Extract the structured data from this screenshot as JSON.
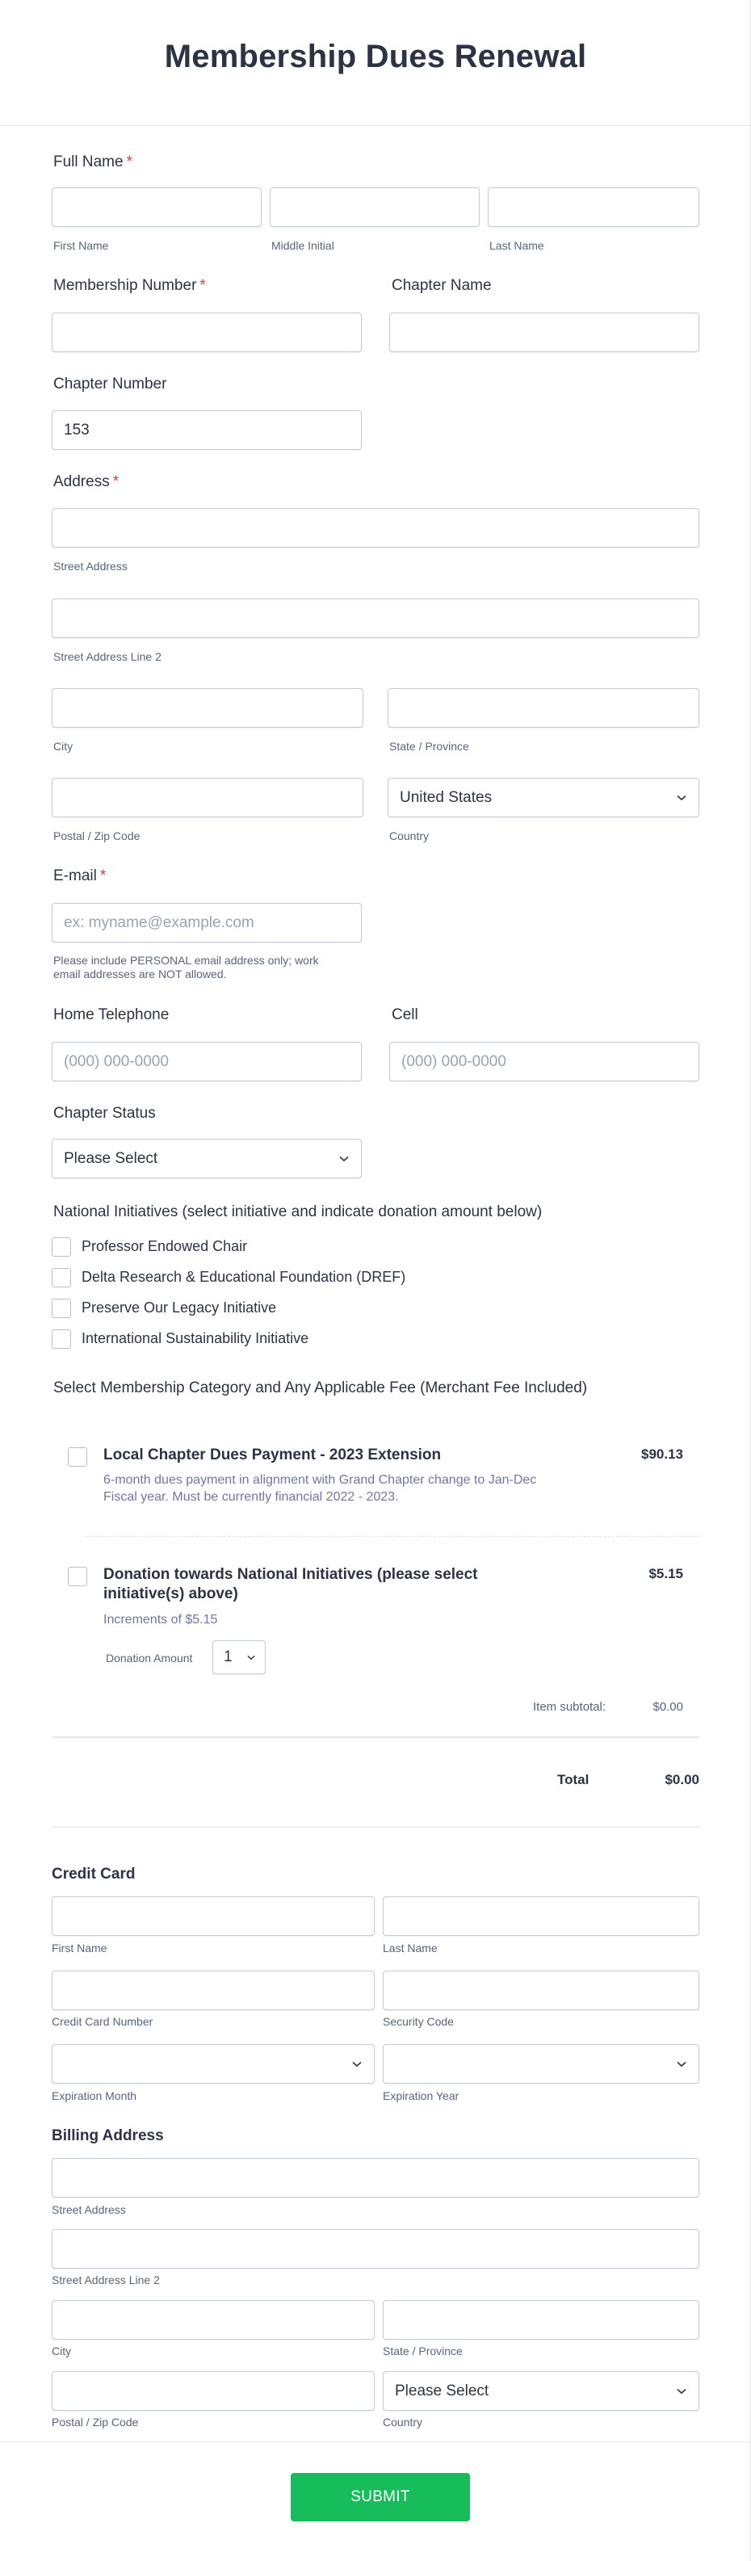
{
  "form": {
    "title": "Membership Dues Renewal",
    "required_mark": "*",
    "full_name": {
      "label": "Full Name",
      "sublabels": [
        "First Name",
        "Middle Initial",
        "Last Name"
      ],
      "values": [
        "",
        "",
        ""
      ]
    },
    "membership_number": {
      "label": "Membership Number",
      "value": ""
    },
    "chapter_name": {
      "label": "Chapter Name",
      "value": ""
    },
    "chapter_number": {
      "label": "Chapter Number",
      "value": "153"
    },
    "address": {
      "label": "Address",
      "street_sublabel": "Street Address",
      "street2_sublabel": "Street Address Line 2",
      "city_sublabel": "City",
      "state_sublabel": "State / Province",
      "zip_sublabel": "Postal / Zip Code",
      "country_sublabel": "Country",
      "country_value": "United States"
    },
    "email": {
      "label": "E-mail",
      "placeholder": "ex: myname@example.com",
      "help_line1": "Please include PERSONAL email address only; work",
      "help_line2": "email addresses are NOT allowed."
    },
    "home_telephone": {
      "label": "Home Telephone",
      "placeholder": "(000) 000-0000"
    },
    "cell": {
      "label": "Cell",
      "placeholder": "(000) 000-0000"
    },
    "chapter_status": {
      "label": "Chapter Status",
      "value": "Please Select"
    },
    "national_initiatives": {
      "label": "National Initiatives (select initiative and indicate donation amount below)",
      "options": [
        {
          "label": "Professor Endowed Chair",
          "checked": false
        },
        {
          "label": "Delta Research & Educational Foundation (DREF)",
          "checked": false
        },
        {
          "label": "Preserve Our Legacy Initiative",
          "checked": false
        },
        {
          "label": "International Sustainability Initiative",
          "checked": false
        }
      ]
    },
    "membership_category": {
      "label": "Select Membership Category and Any Applicable Fee (Merchant Fee Included)",
      "products": [
        {
          "title": "Local Chapter Dues Payment - 2023 Extension",
          "desc_line1": "6-month dues payment in alignment with Grand Chapter change to Jan-Dec",
          "desc_line2": "Fiscal year. Must be currently financial 2022 - 2023.",
          "price": "$90.13",
          "checked": false
        },
        {
          "title_line1": "Donation towards National Initiatives (please select",
          "title_line2": "initiative(s) above)",
          "desc": "Increments of $5.15",
          "price": "$5.15",
          "checked": false,
          "quantity_label": "Donation Amount",
          "quantity_value": "1"
        }
      ],
      "subtotal_label": "Item subtotal:",
      "subtotal_value": "$0.00",
      "total_label": "Total",
      "total_value": "$0.00"
    },
    "credit_card": {
      "heading": "Credit Card",
      "first_name": "First Name",
      "last_name": "Last Name",
      "card_number": "Credit Card Number",
      "security_code": "Security Code",
      "exp_month": "Expiration Month",
      "exp_year": "Expiration Year"
    },
    "billing_address": {
      "heading": "Billing Address",
      "street_sublabel": "Street Address",
      "street2_sublabel": "Street Address Line 2",
      "city_sublabel": "City",
      "state_sublabel": "State / Province",
      "zip_sublabel": "Postal / Zip Code",
      "country_sublabel": "Country",
      "country_value": "Please Select"
    },
    "submit_label": "SUBMIT",
    "colors": {
      "accent_submit": "#18bd5b",
      "required": "#e53935",
      "text": "#2c3345"
    }
  }
}
